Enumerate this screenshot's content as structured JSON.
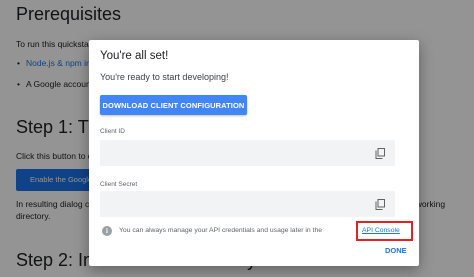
{
  "background": {
    "heading_prereq": "Prerequisites",
    "intro_text": "To run this quickstart, you need the following prerequisites:",
    "bullet_1": "Node.js & npm installed.",
    "bullet_2": "A Google account",
    "heading_step1": "Step 1: Turn on the Drive API",
    "step1_text": "Click this button to create a new Cloud Platform project and automatically enable the Drive API:",
    "enable_button": "Enable the Google Drive API",
    "resulting_text": "In resulting dialog click DOWNLOAD CLIENT CONFIGURATION and save the file credentials.json to your working",
    "directory_text": "directory.",
    "heading_step2": "Step 2: Install the client library"
  },
  "dialog": {
    "title": "You're all set!",
    "subtitle": "You're ready to start developing!",
    "download_button": "DOWNLOAD CLIENT CONFIGURATION",
    "client_id_label": "Client ID",
    "client_secret_label": "Client Secret",
    "info_text": "You can always manage your API credentials and usage later in the",
    "api_console_link": "API Console",
    "done_button": "DONE"
  },
  "colors": {
    "accent": "#4285f4",
    "link": "#1a73e8",
    "highlight": "#e02424"
  },
  "icons": {
    "copy": "copy-icon",
    "info": "info-icon"
  }
}
